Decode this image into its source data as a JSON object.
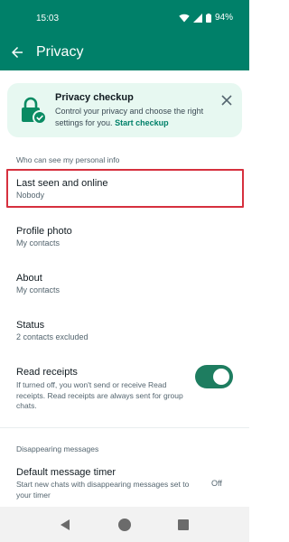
{
  "status_bar": {
    "time": "15:03",
    "battery": "94%",
    "icons": [
      "wifi-icon",
      "signal-icon",
      "battery-icon"
    ]
  },
  "app_bar": {
    "title": "Privacy",
    "back_icon": "arrow-left-icon",
    "color": "#008069"
  },
  "privacy_checkup": {
    "title": "Privacy checkup",
    "description": "Control your privacy and choose the right settings for you.",
    "link": "Start checkup",
    "icon": "lock-check-icon",
    "close_icon": "close-icon",
    "background": "#e7f8f1"
  },
  "personal_info": {
    "header": "Who can see my personal info",
    "items": [
      {
        "label": "Last seen and online",
        "value": "Nobody"
      },
      {
        "label": "Profile photo",
        "value": "My contacts"
      },
      {
        "label": "About",
        "value": "My contacts"
      },
      {
        "label": "Status",
        "value": "2 contacts excluded"
      }
    ],
    "highlighted_item": "Last seen and online",
    "highlight_color": "#d6303e"
  },
  "read_receipts": {
    "label": "Read receipts",
    "description": "If turned off, you won't send or receive Read receipts. Read receipts are always sent for group chats.",
    "enabled": true,
    "toggle_color": "#1e7d60"
  },
  "disappearing": {
    "header": "Disappearing messages",
    "timer_label": "Default message timer",
    "timer_description": "Start new chats with disappearing messages set to your timer",
    "timer_value": "Off"
  },
  "nav_bar": {
    "icons": [
      "back-triangle-icon",
      "home-circle-icon",
      "recents-square-icon"
    ]
  }
}
